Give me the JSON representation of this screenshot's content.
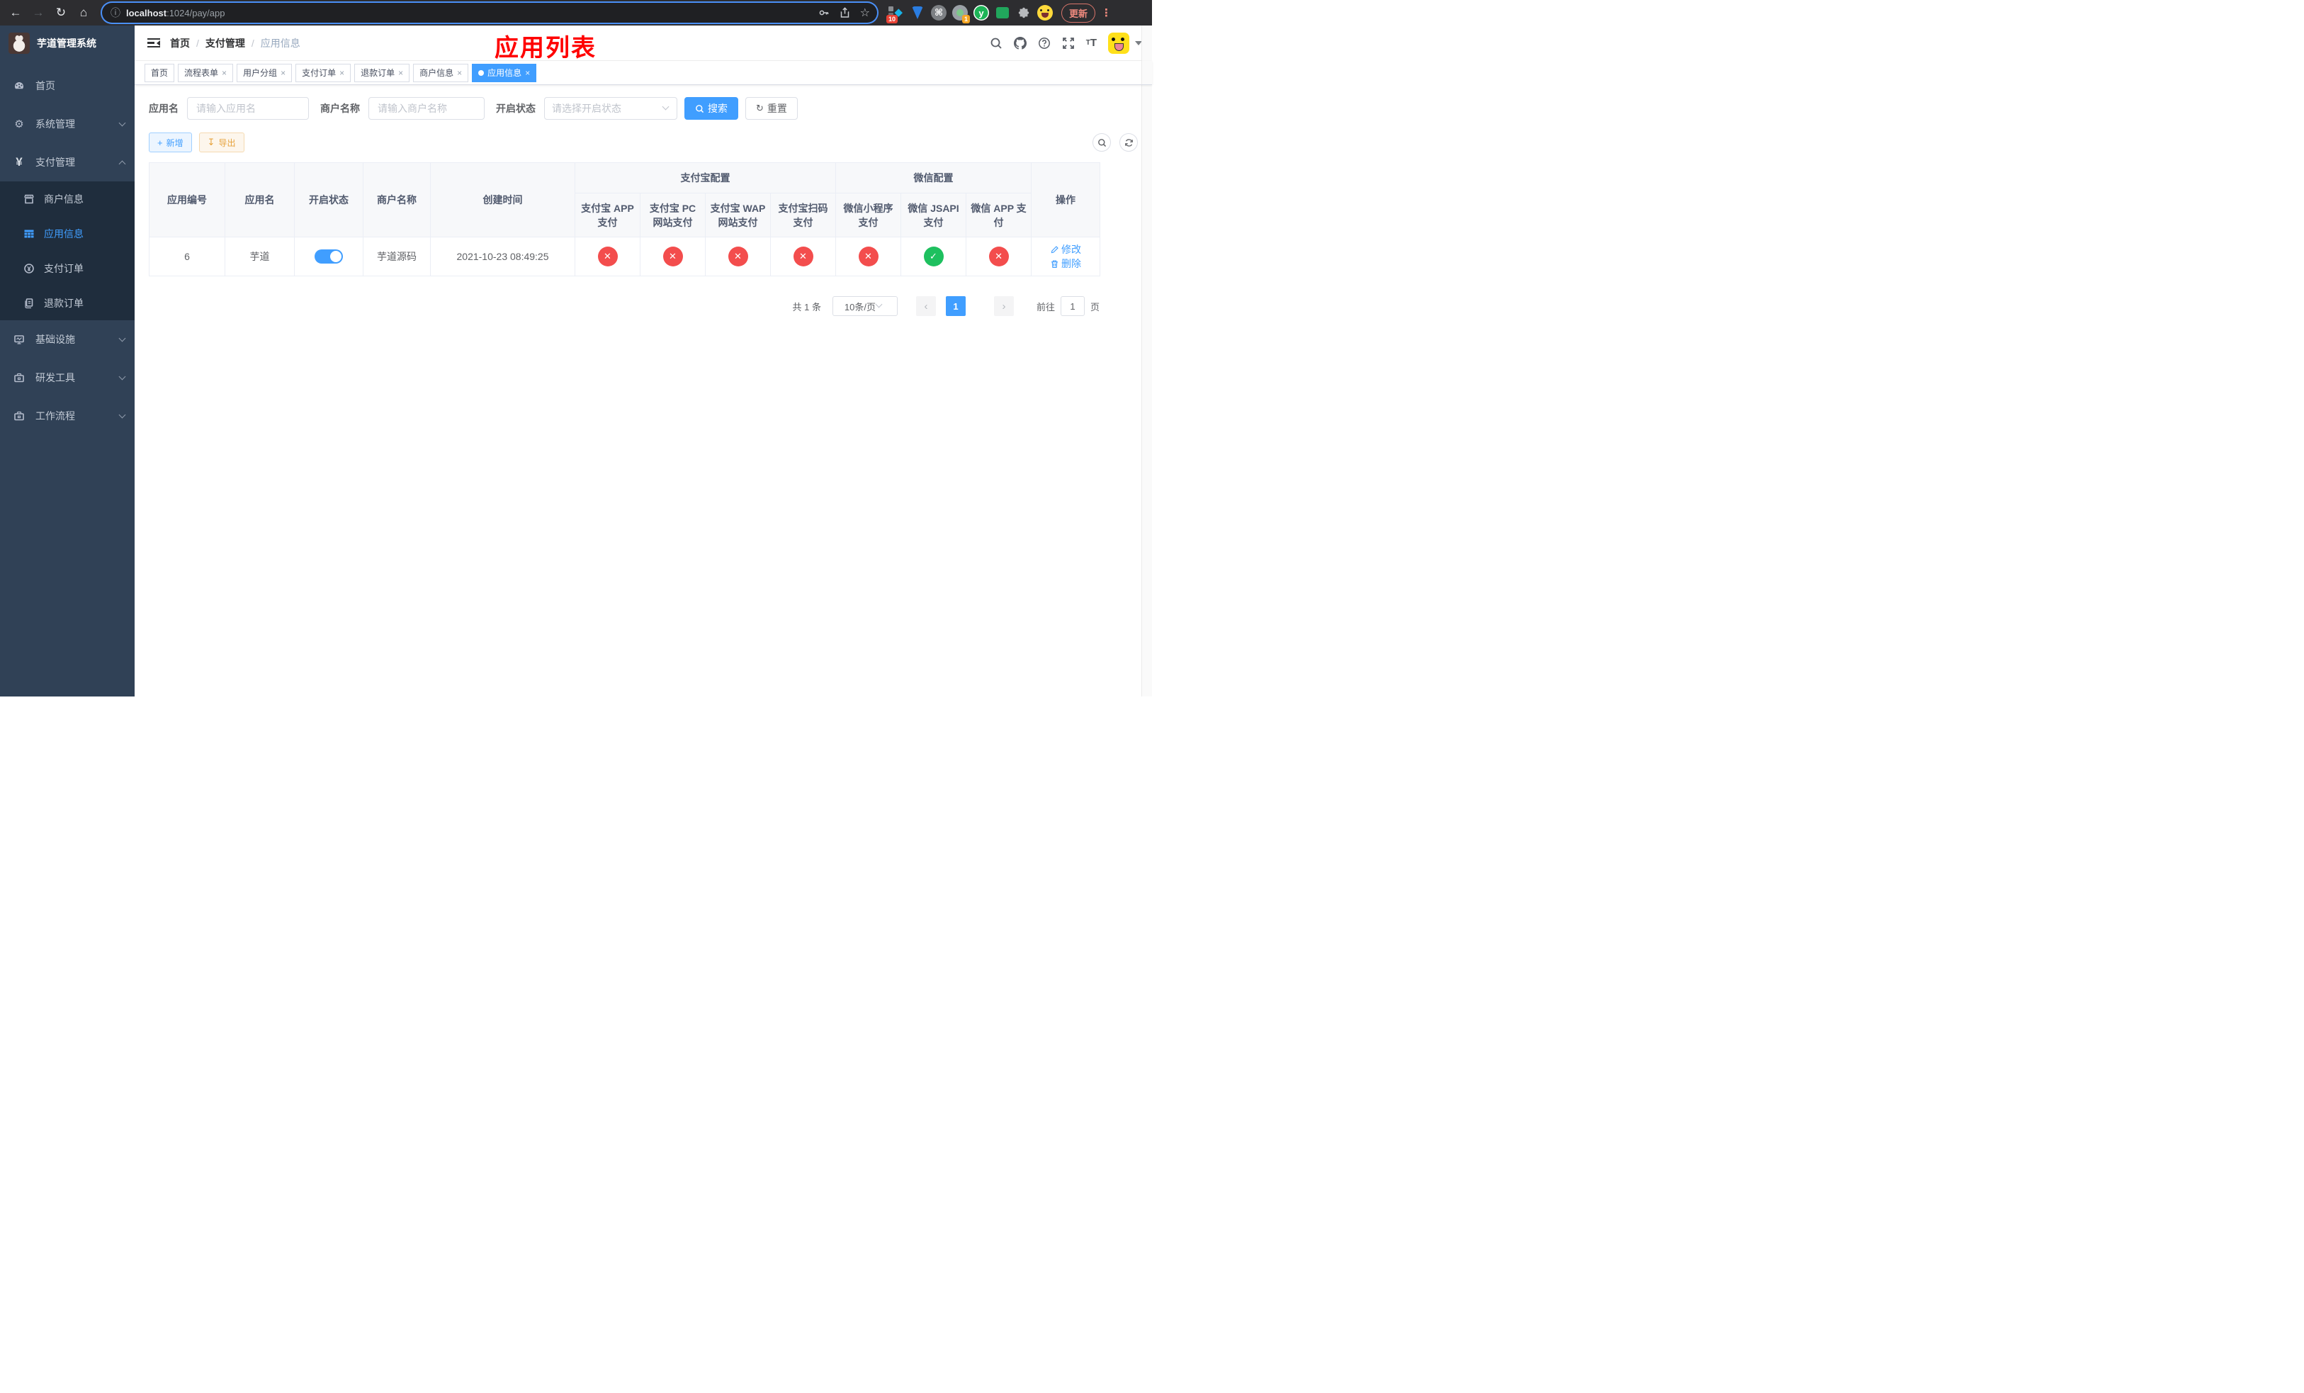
{
  "icons": {
    "back": "←",
    "forward": "→",
    "reload": "↻",
    "home": "⌂",
    "info": "ⓘ",
    "star": "☆",
    "cmd": "⌘",
    "kebab": "⋮",
    "diamond": "◆",
    "puzzle": "✦",
    "gear": "⚙",
    "yen": "¥",
    "coin_yen": "¥",
    "ext_y": "y",
    "plus": "+",
    "download": "↧",
    "refresh": "↻",
    "check": "✓",
    "cross": "✕",
    "prev": "‹",
    "next": "›"
  },
  "browser": {
    "url_host": "localhost",
    "url_rest": ":1024/pay/app",
    "ext_badge_1": "10",
    "ext_badge_2": "1",
    "update_label": "更新"
  },
  "sidebar": {
    "title": "芋道管理系统",
    "items": [
      {
        "label": "首页"
      },
      {
        "label": "系统管理"
      },
      {
        "label": "支付管理"
      },
      {
        "label": "基础设施"
      },
      {
        "label": "研发工具"
      },
      {
        "label": "工作流程"
      }
    ],
    "pay_children": [
      {
        "label": "商户信息"
      },
      {
        "label": "应用信息",
        "active": true
      },
      {
        "label": "支付订单"
      },
      {
        "label": "退款订单"
      }
    ]
  },
  "navbar": {
    "breadcrumb": [
      "首页",
      "支付管理",
      "应用信息"
    ],
    "annotation": "应用列表"
  },
  "tabs": [
    {
      "label": "首页"
    },
    {
      "label": "流程表单"
    },
    {
      "label": "用户分组"
    },
    {
      "label": "支付订单"
    },
    {
      "label": "退款订单"
    },
    {
      "label": "商户信息"
    },
    {
      "label": "应用信息"
    }
  ],
  "search_form": {
    "fields": [
      {
        "label": "应用名",
        "placeholder": "请输入应用名"
      },
      {
        "label": "商户名称",
        "placeholder": "请输入商户名称"
      },
      {
        "label": "开启状态",
        "placeholder": "请选择开启状态"
      }
    ],
    "search_label": "搜索",
    "reset_label": "重置"
  },
  "toolbar": {
    "add_label": "新增",
    "export_label": "导出"
  },
  "table": {
    "columns": [
      "应用编号",
      "应用名",
      "开启状态",
      "商户名称",
      "创建时间"
    ],
    "groups": [
      {
        "label": "支付宝配置",
        "children": [
          "支付宝 APP 支付",
          "支付宝 PC 网站支付",
          "支付宝 WAP 网站支付",
          "支付宝扫码支付"
        ]
      },
      {
        "label": "微信配置",
        "children": [
          "微信小程序支付",
          "微信 JSAPI 支付",
          "微信 APP 支付"
        ]
      }
    ],
    "action_column": "操作",
    "rows": [
      {
        "id": "6",
        "name": "芋道",
        "enabled": true,
        "merchant": "芋道源码",
        "created": "2021-10-23 08:49:25",
        "statuses": [
          "no",
          "no",
          "no",
          "no",
          "no",
          "yes",
          "no"
        ],
        "edit_label": "修改",
        "delete_label": "删除"
      }
    ]
  },
  "pagination": {
    "total": "共 1 条",
    "page_size": "10条/页",
    "current_page": "1",
    "goto_label": "前往",
    "goto_value": "1",
    "unit_label": "页"
  },
  "colors": {
    "primary": "#409eff",
    "sidebar_bg": "#304156",
    "submenu_bg": "#1f2d3d",
    "status_no": "#f34d4d",
    "status_yes": "#1ec05f",
    "annotation_red": "#ff0000",
    "warning": "#e6a23c"
  }
}
